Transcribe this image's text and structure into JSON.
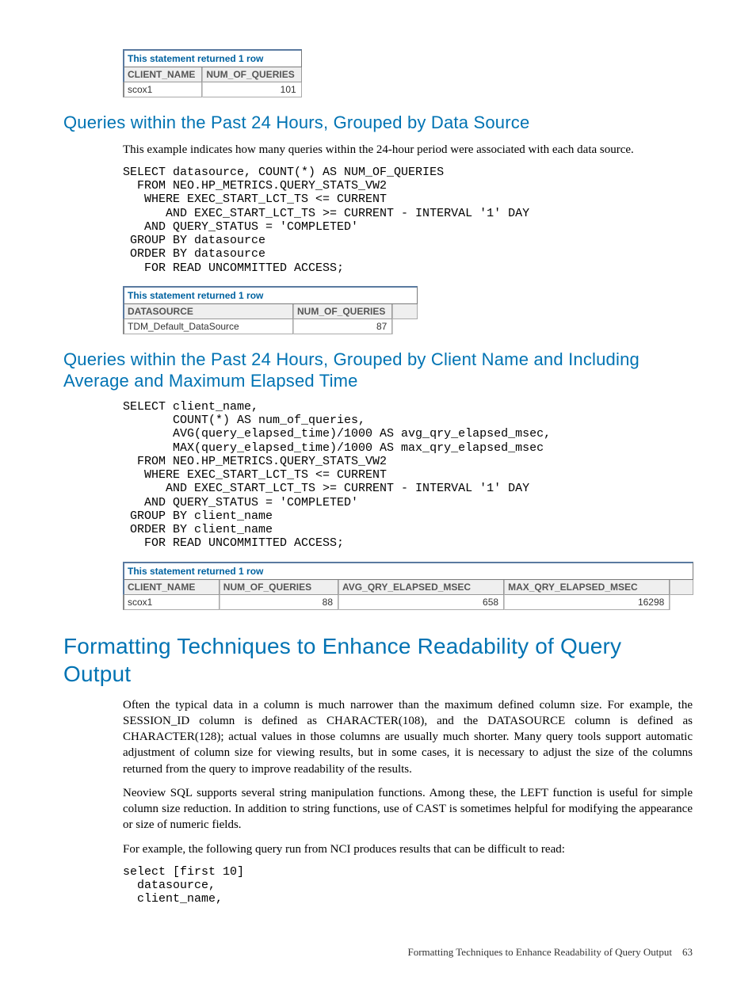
{
  "table1": {
    "caption": "This statement returned 1 row",
    "headers": [
      "CLIENT_NAME",
      "NUM_OF_QUERIES"
    ],
    "rows": [
      {
        "c0": "scox1",
        "c1": "101"
      }
    ]
  },
  "section1": {
    "heading": "Queries within the Past 24 Hours, Grouped by Data Source",
    "para": "This example indicates how many queries within the 24-hour period were associated with each data source.",
    "code": "SELECT datasource, COUNT(*) AS NUM_OF_QUERIES\n  FROM NEO.HP_METRICS.QUERY_STATS_VW2\n   WHERE EXEC_START_LCT_TS <= CURRENT\n      AND EXEC_START_LCT_TS >= CURRENT - INTERVAL '1' DAY\n   AND QUERY_STATUS = 'COMPLETED'\n GROUP BY datasource\n ORDER BY datasource\n   FOR READ UNCOMMITTED ACCESS;"
  },
  "table2": {
    "caption": "This statement returned 1 row",
    "headers": [
      "DATASOURCE",
      "NUM_OF_QUERIES"
    ],
    "rows": [
      {
        "c0": "TDM_Default_DataSource",
        "c1": "87"
      }
    ]
  },
  "section2": {
    "heading": "Queries within the Past 24 Hours, Grouped by Client Name and Including Average and Maximum Elapsed Time",
    "code": "SELECT client_name,\n       COUNT(*) AS num_of_queries,\n       AVG(query_elapsed_time)/1000 AS avg_qry_elapsed_msec,\n       MAX(query_elapsed_time)/1000 AS max_qry_elapsed_msec\n  FROM NEO.HP_METRICS.QUERY_STATS_VW2\n   WHERE EXEC_START_LCT_TS <= CURRENT\n      AND EXEC_START_LCT_TS >= CURRENT - INTERVAL '1' DAY\n   AND QUERY_STATUS = 'COMPLETED'\n GROUP BY client_name\n ORDER BY client_name\n   FOR READ UNCOMMITTED ACCESS;"
  },
  "table3": {
    "caption": "This statement returned 1 row",
    "headers": [
      "CLIENT_NAME",
      "NUM_OF_QUERIES",
      "AVG_QRY_ELAPSED_MSEC",
      "MAX_QRY_ELAPSED_MSEC"
    ],
    "rows": [
      {
        "c0": "scox1",
        "c1": "88",
        "c2": "658",
        "c3": "16298"
      }
    ]
  },
  "section3": {
    "heading": "Formatting Techniques to Enhance Readability of Query Output",
    "para1": "Often the typical data in a column is much narrower than the maximum defined column size. For example, the SESSION_ID column is defined as CHARACTER(108), and the DATASOURCE column is defined as CHARACTER(128); actual values in those columns are usually much shorter. Many query tools support automatic adjustment of column size for viewing results, but in some cases, it is necessary to adjust the size of the columns returned from the query to improve readability of the results.",
    "para2": "Neoview SQL supports several string manipulation functions. Among these, the LEFT function is useful for simple column size reduction. In addition to string functions, use of CAST is sometimes helpful for modifying the appearance or size of numeric fields.",
    "para3": "For example, the following query run from NCI produces results that can be difficult to read:",
    "code": "select [first 10]\n  datasource,\n  client_name,"
  },
  "footer": {
    "text": "Formatting Techniques to Enhance Readability of Query Output",
    "page": "63"
  }
}
